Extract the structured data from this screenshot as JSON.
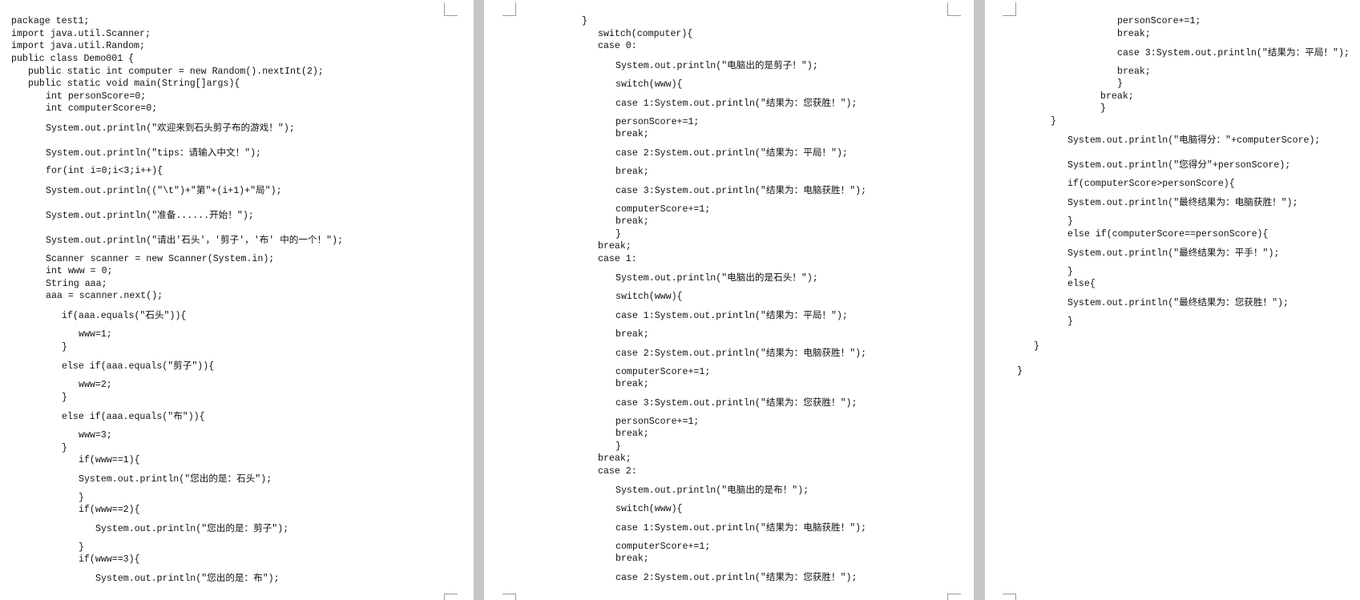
{
  "pages": [
    {
      "lines": [
        "package test1;",
        "import java.util.Scanner;",
        "import java.util.Random;",
        "public class Demo001 {",
        "public static int computer = new Random().nextInt(2);",
        "public static void main(String[]args){",
        "int personScore=0;",
        "int computerScore=0;",
        "System.out.println(\"欢迎来到石头剪子布的游戏！\");",
        "System.out.println(\"tips：请输入中文！\");",
        "for(int i=0;i<3;i++){",
        "System.out.println((\"\\t\")+\"第\"+(i+1)+\"局\");",
        "System.out.println(\"准备......开始！\");",
        "System.out.println(\"请出'石头'，'剪子'，'布' 中的一个！\");",
        "Scanner scanner = new Scanner(System.in);",
        "int www = 0;",
        "String aaa;",
        "aaa = scanner.next();",
        "if(aaa.equals(\"石头\")){",
        "www=1;",
        "}",
        "else if(aaa.equals(\"剪子\")){",
        "www=2;",
        "}",
        "else if(aaa.equals(\"布\")){",
        "www=3;",
        "}",
        "if(www==1){",
        "System.out.println(\"您出的是：石头\");",
        "}",
        "if(www==2){",
        "System.out.println(\"您出的是：剪子\");",
        "}",
        "if(www==3){",
        "System.out.println(\"您出的是：布\");"
      ]
    },
    {
      "lines": [
        "}",
        "switch(computer){",
        "case 0:",
        "System.out.println(\"电脑出的是剪子！\");",
        "switch(www){",
        "case 1:System.out.println(\"结果为：您获胜！\");",
        "personScore+=1;",
        "break;",
        "case 2:System.out.println(\"结果为：平局！\");",
        "break;",
        "case 3:System.out.println(\"结果为：电脑获胜！\");",
        "computerScore+=1;",
        "break;",
        "}",
        "break;",
        "case 1:",
        "System.out.println(\"电脑出的是石头！\");",
        "switch(www){",
        "case 1:System.out.println(\"结果为：平局！\");",
        "break;",
        "case 2:System.out.println(\"结果为：电脑获胜！\");",
        "computerScore+=1;",
        "break;",
        "case 3:System.out.println(\"结果为：您获胜！\");",
        "personScore+=1;",
        "break;",
        "}",
        "break;",
        "case 2:",
        "System.out.println(\"电脑出的是布！\");",
        "switch(www){",
        "case 1:System.out.println(\"结果为：电脑获胜！\");",
        "computerScore+=1;",
        "break;",
        "case 2:System.out.println(\"结果为：您获胜！\");"
      ]
    },
    {
      "lines": [
        "personScore+=1;",
        "break;",
        "case 3:System.out.println(\"结果为：平局！\");",
        "break;",
        "}",
        "break;",
        "}",
        "}",
        "System.out.println(\"电脑得分：\"+computerScore);",
        "System.out.println(\"您得分\"+personScore);",
        "if(computerScore>personScore){",
        "System.out.println(\"最终结果为：电脑获胜！\");",
        "}",
        "else if(computerScore==personScore){",
        "System.out.println(\"最终结果为：平手！\");",
        "}",
        "else{",
        "System.out.println(\"最终结果为：您获胜！\");",
        "}",
        "}",
        "}"
      ]
    }
  ]
}
